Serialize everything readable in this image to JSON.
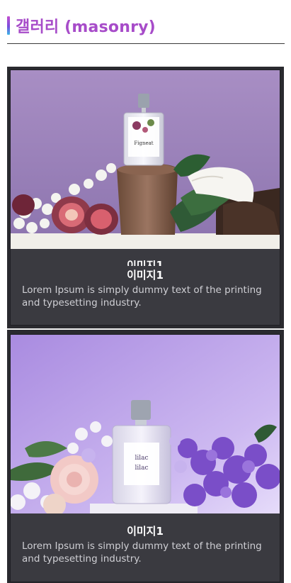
{
  "heading": {
    "title": "갤러리 (masonry)"
  },
  "cards": [
    {
      "image": {
        "subject": "Figneat perfume bottle on wood with figs, coconut and monstera leaves",
        "product_label": "Figneat"
      },
      "ghost_title": "이미지1",
      "title": "이미지1",
      "description": "Lorem Ipsum is simply dummy text of the printing and typesetting industry."
    },
    {
      "image": {
        "subject": "lilac perfume bottle among lilac, hyacinth and rose flowers",
        "product_label": "lilac lilac"
      },
      "title": "이미지1",
      "description": "Lorem Ipsum is simply dummy text of the printing and typesetting industry."
    }
  ],
  "colors": {
    "heading": "#a74cc9",
    "gallery_bg": "#2a2a2f",
    "card_bg": "#3a3a40"
  }
}
